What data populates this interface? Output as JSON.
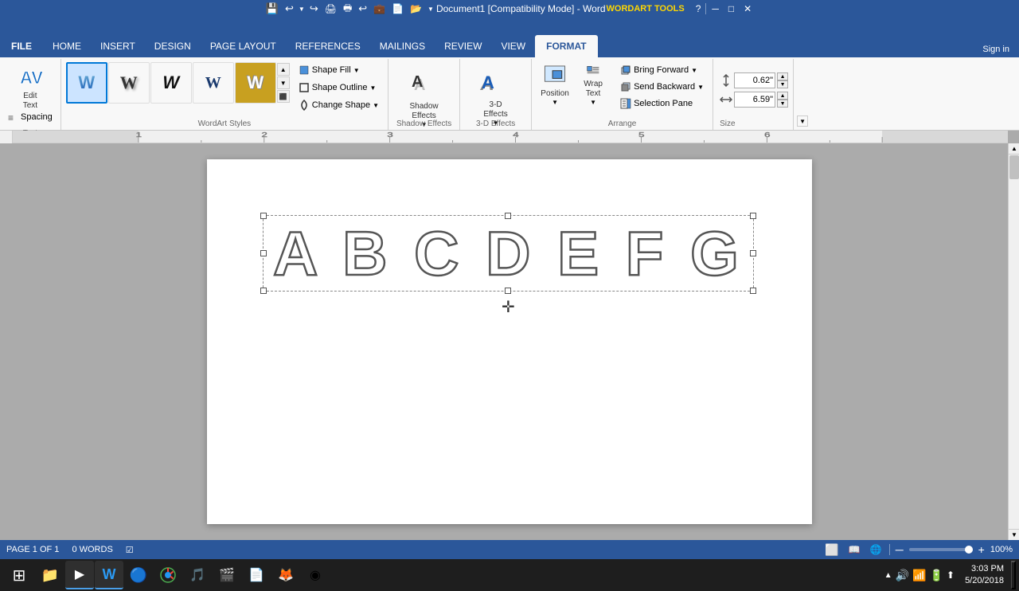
{
  "titlebar": {
    "title": "Document1 [Compatibility Mode] - Word",
    "wordart_tools": "WORDART TOOLS",
    "help_btn": "?",
    "minimize_btn": "─",
    "maximize_btn": "□",
    "close_btn": "✕",
    "signin": "Sign in"
  },
  "qat": {
    "save": "💾",
    "undo": "↩",
    "redo": "↪",
    "print_preview": "🖨",
    "customize": "▼"
  },
  "ribbon": {
    "tabs": [
      "FILE",
      "HOME",
      "INSERT",
      "DESIGN",
      "PAGE LAYOUT",
      "REFERENCES",
      "MAILINGS",
      "REVIEW",
      "VIEW",
      "FORMAT"
    ],
    "active_tab": "FORMAT",
    "groups": {
      "text": {
        "label": "Text",
        "edit_text": "Edit\nText",
        "spacing": "Spacing"
      },
      "wordart_styles": {
        "label": "WordArt Styles",
        "shape_fill": "Shape Fill",
        "shape_outline": "Shape Outline",
        "change_shape": "Change Shape"
      },
      "shadow_effects": {
        "label": "Shadow Effects",
        "shadow_effects": "Shadow\nEffects"
      },
      "threed": {
        "label": "3-D Effects",
        "threed_effects": "3-D\nEffects"
      },
      "arrange": {
        "label": "Arrange",
        "position": "Position",
        "wrap_text": "Wrap\nText",
        "bring_forward": "Bring Forward",
        "send_backward": "Send Backward",
        "selection_pane": "Selection Pane"
      },
      "size": {
        "label": "Size",
        "height_label": "↕",
        "width_label": "↔",
        "height_value": "0.62\"",
        "width_value": "6.59\""
      }
    }
  },
  "wordart_styles": [
    {
      "id": 1,
      "text": "W",
      "style": "blue-gradient",
      "selected": true
    },
    {
      "id": 2,
      "text": "W",
      "style": "shadow"
    },
    {
      "id": 3,
      "text": "W",
      "style": "italic"
    },
    {
      "id": 4,
      "text": "W",
      "style": "bold-dark"
    },
    {
      "id": 5,
      "text": "W",
      "style": "outline"
    }
  ],
  "document": {
    "wordart_content": "A B C D E F G",
    "wordart_display": "ABCDEFG"
  },
  "statusbar": {
    "page_info": "PAGE 1 OF 1",
    "words": "0 WORDS",
    "proofing": "☑",
    "zoom_pct": "100%",
    "zoom_minus": "─",
    "zoom_plus": "+"
  },
  "taskbar": {
    "start_btn": "⊞",
    "file_explorer": "📁",
    "edge_btn": "▶",
    "word_btn": "W",
    "ie_btn": "🔵",
    "chrome_btn": "●",
    "media_btn": "🎵",
    "video_btn": "🎬",
    "adobe_btn": "📄",
    "firefox_btn": "🦊",
    "other_btn": "◉",
    "clock": "3:03 PM\n5/20/2018",
    "tray_icons": [
      "🔊",
      "📶",
      "🔋",
      "⬆"
    ]
  }
}
